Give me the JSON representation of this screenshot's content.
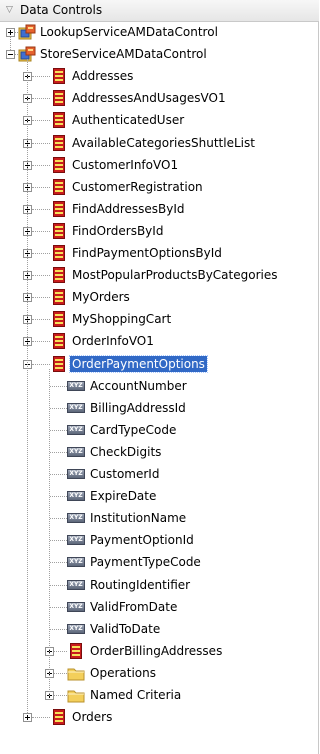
{
  "panel": {
    "title": "Data Controls"
  },
  "tree": [
    {
      "label": "LookupServiceAMDataControl",
      "type": "datacontrol",
      "expander": "plus",
      "depth": 0
    },
    {
      "label": "StoreServiceAMDataControl",
      "type": "datacontrol",
      "expander": "minus",
      "depth": 0
    },
    {
      "label": "Addresses",
      "type": "collection",
      "expander": "plus",
      "depth": 1
    },
    {
      "label": "AddressesAndUsagesVO1",
      "type": "collection",
      "expander": "plus",
      "depth": 1
    },
    {
      "label": "AuthenticatedUser",
      "type": "collection",
      "expander": "plus",
      "depth": 1
    },
    {
      "label": "AvailableCategoriesShuttleList",
      "type": "collection",
      "expander": "plus",
      "depth": 1
    },
    {
      "label": "CustomerInfoVO1",
      "type": "collection",
      "expander": "plus",
      "depth": 1
    },
    {
      "label": "CustomerRegistration",
      "type": "collection",
      "expander": "plus",
      "depth": 1
    },
    {
      "label": "FindAddressesById",
      "type": "collection",
      "expander": "plus",
      "depth": 1
    },
    {
      "label": "FindOrdersById",
      "type": "collection",
      "expander": "plus",
      "depth": 1
    },
    {
      "label": "FindPaymentOptionsById",
      "type": "collection",
      "expander": "plus",
      "depth": 1
    },
    {
      "label": "MostPopularProductsByCategories",
      "type": "collection",
      "expander": "plus",
      "depth": 1
    },
    {
      "label": "MyOrders",
      "type": "collection",
      "expander": "plus",
      "depth": 1
    },
    {
      "label": "MyShoppingCart",
      "type": "collection",
      "expander": "plus",
      "depth": 1
    },
    {
      "label": "OrderInfoVO1",
      "type": "collection",
      "expander": "plus",
      "depth": 1
    },
    {
      "label": "OrderPaymentOptions",
      "type": "collection",
      "expander": "minus",
      "depth": 1,
      "selected": true
    },
    {
      "label": "AccountNumber",
      "type": "attribute",
      "depth": 2
    },
    {
      "label": "BillingAddressId",
      "type": "attribute",
      "depth": 2
    },
    {
      "label": "CardTypeCode",
      "type": "attribute",
      "depth": 2
    },
    {
      "label": "CheckDigits",
      "type": "attribute",
      "depth": 2
    },
    {
      "label": "CustomerId",
      "type": "attribute",
      "depth": 2
    },
    {
      "label": "ExpireDate",
      "type": "attribute",
      "depth": 2
    },
    {
      "label": "InstitutionName",
      "type": "attribute",
      "depth": 2
    },
    {
      "label": "PaymentOptionId",
      "type": "attribute",
      "depth": 2
    },
    {
      "label": "PaymentTypeCode",
      "type": "attribute",
      "depth": 2
    },
    {
      "label": "RoutingIdentifier",
      "type": "attribute",
      "depth": 2
    },
    {
      "label": "ValidFromDate",
      "type": "attribute",
      "depth": 2
    },
    {
      "label": "ValidToDate",
      "type": "attribute",
      "depth": 2
    },
    {
      "label": "OrderBillingAddresses",
      "type": "collection",
      "expander": "plus",
      "depth": 2
    },
    {
      "label": "Operations",
      "type": "folder",
      "expander": "plus",
      "depth": 2
    },
    {
      "label": "Named Criteria",
      "type": "folder",
      "expander": "plus",
      "depth": 2
    },
    {
      "label": "Orders",
      "type": "collection",
      "expander": "plus",
      "depth": 1
    }
  ],
  "attribute_icon_text": "XYZ",
  "colors": {
    "selection": "#3169c6",
    "collection_red": "#c81c1c",
    "collection_stripe": "#f6e15a",
    "folder": "#f3cf5b"
  }
}
